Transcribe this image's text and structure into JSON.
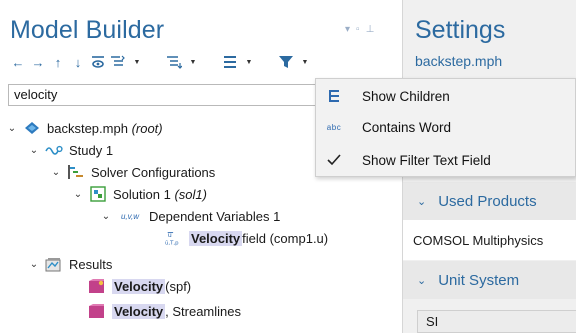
{
  "model_builder": {
    "title": "Model Builder",
    "search_value": "velocity"
  },
  "tree": {
    "root_label": "backstep.mph",
    "root_tag": "(root)",
    "study": "Study 1",
    "solver_configs": "Solver Configurations",
    "solution": "Solution 1",
    "solution_tag": "(sol1)",
    "dependent_vars": "Dependent Variables 1",
    "dv_icon_text": "u,v,w",
    "velocity_field_hl": "Velocity",
    "velocity_field_rest": " field (comp1.u)",
    "results": "Results",
    "velocity_spf_hl": "Velocity",
    "velocity_spf_rest": " (spf)",
    "velocity_stream_hl": "Velocity",
    "velocity_stream_rest": ", Streamlines"
  },
  "menu": {
    "items": [
      {
        "label": "Show Children",
        "icon": "tree-children-icon"
      },
      {
        "label": "Contains Word",
        "icon": "abc-icon",
        "icon_text": "abc"
      },
      {
        "label": "Show Filter Text Field",
        "icon": "checkmark-icon",
        "checked": true
      }
    ]
  },
  "settings": {
    "title": "Settings",
    "subtitle": "backstep.mph",
    "used_products_header": "Used Products",
    "used_products_value": "COMSOL Multiphysics",
    "unit_system_header": "Unit System",
    "unit_system_value": "SI"
  },
  "colors": {
    "accent": "#2c6aa0",
    "highlight": "#d8d8f0",
    "menu_bg": "#f2f2f2",
    "settings_bg": "#f0f0f0"
  }
}
